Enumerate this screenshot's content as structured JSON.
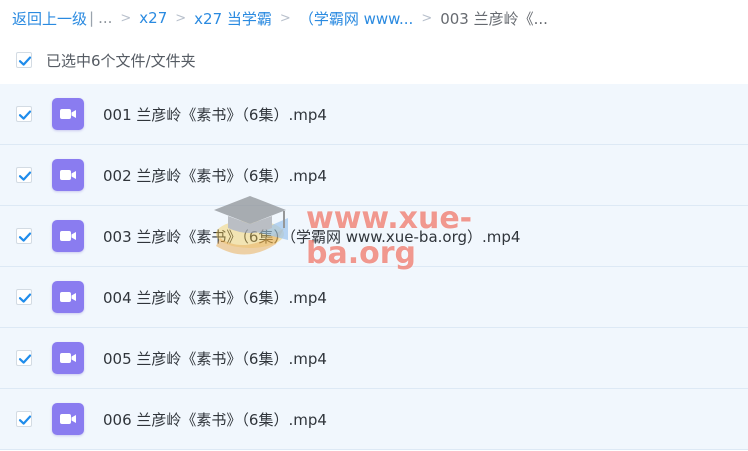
{
  "breadcrumb": {
    "back_label": "返回上一级",
    "pipe": "|",
    "ellipsis": "...",
    "sep": ">",
    "items": [
      {
        "label": "x27"
      },
      {
        "label": "x27 当学霸"
      },
      {
        "label": "（学霸网 www..."
      },
      {
        "label": "003 兰彦岭《..."
      }
    ]
  },
  "selection": {
    "label": "已选中6个文件/文件夹",
    "checked": true
  },
  "files": [
    {
      "name": "001 兰彦岭《素书》（6集）.mp4",
      "type": "video",
      "checked": true
    },
    {
      "name": "002 兰彦岭《素书》（6集）.mp4",
      "type": "video",
      "checked": true
    },
    {
      "name": "003 兰彦岭《素书》（6集）（学霸网 www.xue-ba.org）.mp4",
      "type": "video",
      "checked": true
    },
    {
      "name": "004 兰彦岭《素书》（6集）.mp4",
      "type": "video",
      "checked": true
    },
    {
      "name": "005 兰彦岭《素书》（6集）.mp4",
      "type": "video",
      "checked": true
    },
    {
      "name": "006 兰彦岭《素书》（6集）.mp4",
      "type": "video",
      "checked": true
    }
  ],
  "watermark": {
    "text": "www.xue-ba.org",
    "icon": "graduation-cap-icon"
  },
  "colors": {
    "link": "#2a8ae0",
    "check": "#1f8ceb",
    "video_icon": "#8a7cf0",
    "row_bg": "#f1f7fd"
  }
}
